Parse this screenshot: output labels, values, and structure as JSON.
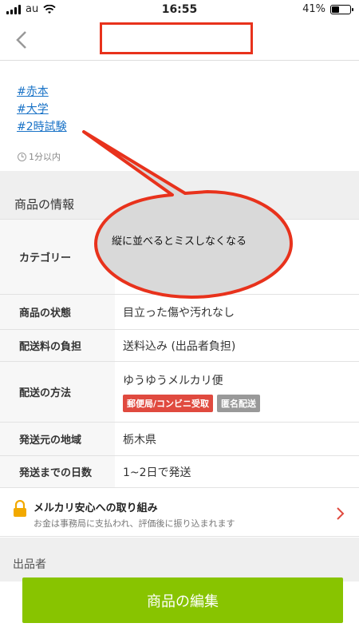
{
  "status_bar": {
    "carrier": "au",
    "time": "16:55",
    "battery_text": "41%",
    "battery_level": 0.41
  },
  "hashtags": [
    "#赤本",
    "#大学",
    "#2時試験"
  ],
  "posted_time": "1分以内",
  "info_section": {
    "title": "商品の情報",
    "rows": {
      "category": {
        "label": "カテゴリー",
        "value": ""
      },
      "condition": {
        "label": "商品の状態",
        "value": "目立った傷や汚れなし"
      },
      "shipping_fee": {
        "label": "配送料の負担",
        "value": "送料込み (出品者負担)"
      },
      "shipping_method": {
        "label": "配送の方法",
        "value": "ゆうゆうメルカリ便",
        "badge_red": "郵便局/コンビニ受取",
        "badge_gray": "匿名配送"
      },
      "ship_from": {
        "label": "発送元の地域",
        "value": "栃木県"
      },
      "days": {
        "label": "発送までの日数",
        "value": "1~2日で発送"
      }
    }
  },
  "safety": {
    "title": "メルカリ安心への取り組み",
    "subtitle": "お金は事務局に支払われ、評価後に振り込まれます"
  },
  "clipped_heading": "出品者",
  "edit_button": "商品の編集",
  "annotation": "縦に並べるとミスしなくなる",
  "colors": {
    "link": "#1a73c7",
    "accent_green": "#88c400",
    "badge_red": "#e04a3f",
    "annotation_red": "#e8321c"
  }
}
